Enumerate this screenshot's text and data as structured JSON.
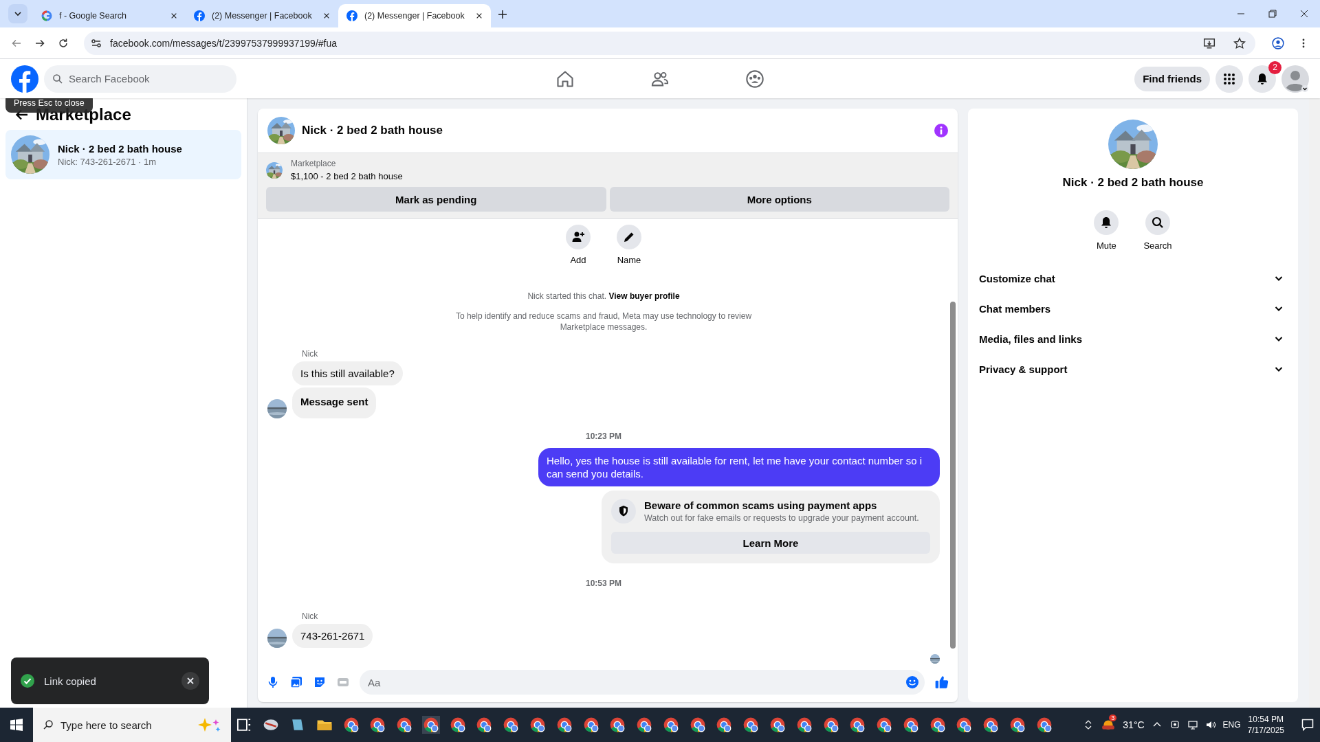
{
  "browser": {
    "tabs": [
      {
        "title": "f - Google Search",
        "selected": false
      },
      {
        "title": "(2) Messenger | Facebook",
        "selected": false
      },
      {
        "title": "(2) Messenger | Facebook",
        "selected": true
      }
    ],
    "url": "facebook.com/messages/t/23997537999937199/#fua"
  },
  "header": {
    "search": {
      "placeholder": "Search Facebook"
    },
    "find_friends": "Find friends",
    "notification_count": "2"
  },
  "tooltip": "Press Esc to close",
  "sidebar": {
    "title": "Marketplace",
    "items": [
      {
        "title": "Nick · 2 bed 2 bath house",
        "subtitle": "Nick: 743-261-2671 · 1m",
        "selected": true
      }
    ]
  },
  "chat": {
    "title": "Nick · 2 bed 2 bath house",
    "listing": {
      "label": "Marketplace",
      "detail": "$1,100 - 2 bed 2 bath house"
    },
    "actions": [
      "Mark as pending",
      "More options"
    ],
    "quick_actions": [
      {
        "kind": "add",
        "label": "Add"
      },
      {
        "kind": "name",
        "label": "Name"
      }
    ],
    "notice": {
      "text": "Nick started this chat.",
      "link": "View buyer profile"
    },
    "disclaimer": "To help identify and reduce scams and fraud, Meta may use technology to review Marketplace messages.",
    "messages": [
      {
        "kind": "sender",
        "text": "Nick"
      },
      {
        "kind": "incoming",
        "text": "Is this still available?",
        "emphasis": false,
        "avatar": false
      },
      {
        "kind": "incoming",
        "text": "Message sent",
        "emphasis": true,
        "avatar": true
      },
      {
        "kind": "time",
        "text": "10:23 PM"
      },
      {
        "kind": "outgoing",
        "text": "Hello, yes the house is still available for rent, let me have your contact number so i can send you details."
      },
      {
        "kind": "warning",
        "title": "Beware of common scams using payment apps",
        "text": "Watch out for fake emails or requests to upgrade your payment account.",
        "button": "Learn More"
      },
      {
        "kind": "time",
        "text": "10:53 PM"
      },
      {
        "kind": "sender",
        "text": "Nick"
      },
      {
        "kind": "incoming",
        "text": "743-261-2671",
        "emphasis": false,
        "avatar": true
      }
    ],
    "composer": {
      "placeholder": "Aa"
    }
  },
  "details": {
    "title": "Nick · 2 bed 2 bath house",
    "actions": [
      {
        "kind": "mute",
        "label": "Mute"
      },
      {
        "kind": "search",
        "label": "Search"
      }
    ],
    "sections": [
      {
        "label": "Customize chat",
        "expanded": false
      },
      {
        "label": "Chat members",
        "expanded": false
      },
      {
        "label": "Media, files and links",
        "expanded": false
      },
      {
        "label": "Privacy & support",
        "expanded": false
      }
    ]
  },
  "toast": {
    "text": "Link copied"
  },
  "taskbar": {
    "search": {
      "placeholder": "Type here to search"
    },
    "weather_badge": "3",
    "temperature": "31°C",
    "language": "ENG",
    "time": "10:54 PM",
    "date": "7/17/2025"
  }
}
